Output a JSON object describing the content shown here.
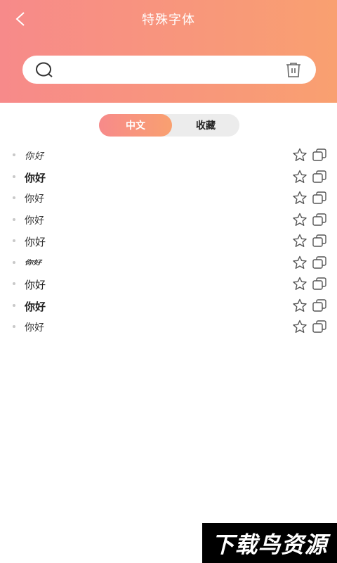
{
  "header": {
    "title": "特殊字体",
    "back_icon": "chevron-left-icon",
    "gradient": [
      "#f78a8a",
      "#f9a070"
    ]
  },
  "search": {
    "value": "",
    "placeholder": "",
    "search_icon": "search-icon",
    "clear_icon": "trash-icon"
  },
  "tabs": [
    {
      "label": "中文",
      "active": true
    },
    {
      "label": "收藏",
      "active": false
    }
  ],
  "list": [
    {
      "text": "你好"
    },
    {
      "text": "你好"
    },
    {
      "text": "你好"
    },
    {
      "text": "你好"
    },
    {
      "text": "你好"
    },
    {
      "text": "你好"
    },
    {
      "text": "你好"
    },
    {
      "text": "你好"
    },
    {
      "text": "你好"
    }
  ],
  "row_icons": {
    "favorite": "star-outline-icon",
    "copy": "copy-icon"
  },
  "watermark": {
    "text": "下载鸟资源"
  }
}
